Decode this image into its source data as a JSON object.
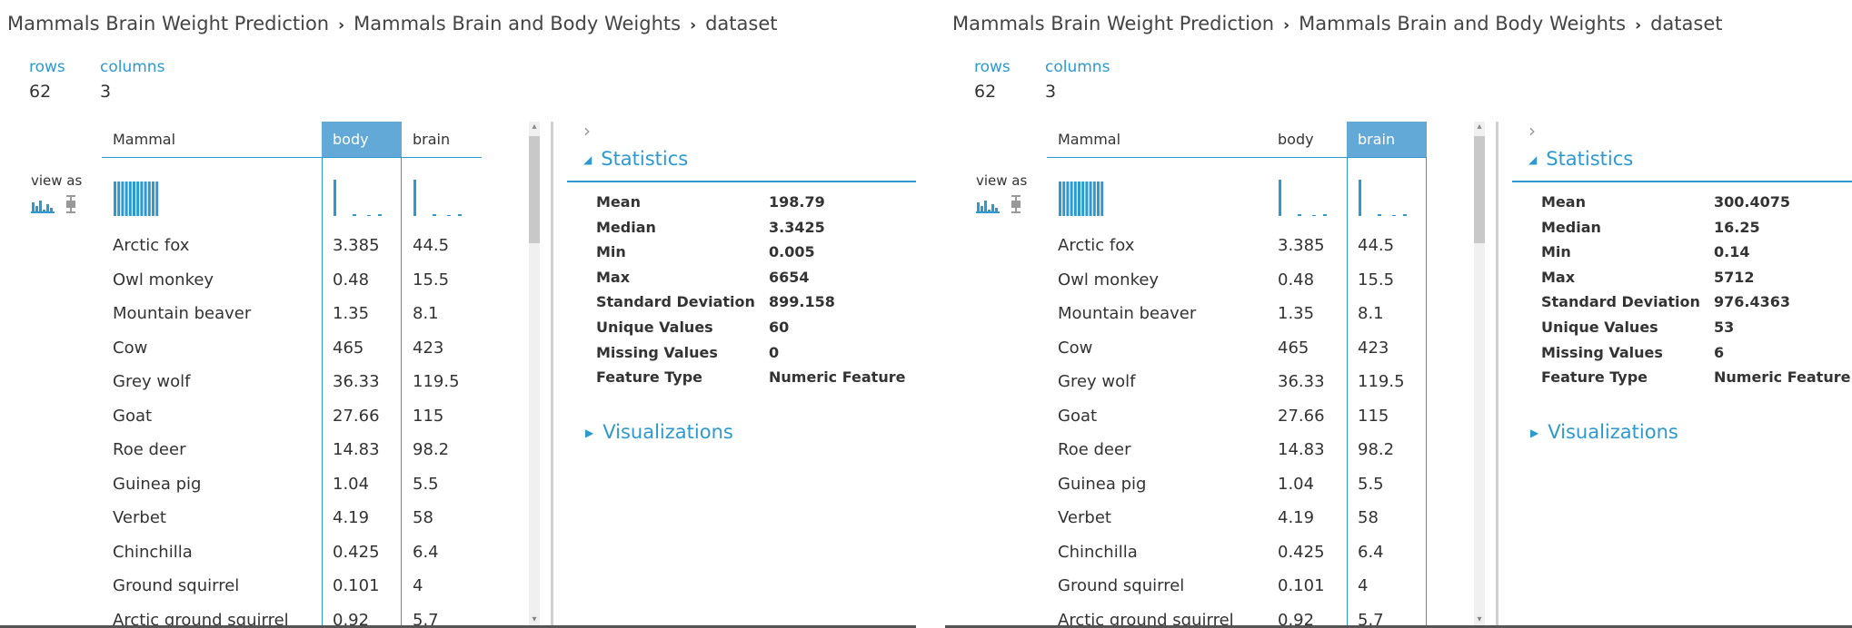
{
  "panels": [
    {
      "breadcrumb": [
        "Mammals Brain Weight Prediction",
        "Mammals Brain and Body Weights",
        "dataset"
      ],
      "rows_label": "rows",
      "rows_value": "62",
      "columns_label": "columns",
      "columns_value": "3",
      "view_as_label": "view as",
      "columns": [
        "Mammal",
        "body",
        "brain"
      ],
      "selected_column": "body",
      "rows": [
        [
          "Arctic fox",
          "3.385",
          "44.5"
        ],
        [
          "Owl monkey",
          "0.48",
          "15.5"
        ],
        [
          "Mountain beaver",
          "1.35",
          "8.1"
        ],
        [
          "Cow",
          "465",
          "423"
        ],
        [
          "Grey wolf",
          "36.33",
          "119.5"
        ],
        [
          "Goat",
          "27.66",
          "115"
        ],
        [
          "Roe deer",
          "14.83",
          "98.2"
        ],
        [
          "Guinea pig",
          "1.04",
          "5.5"
        ],
        [
          "Verbet",
          "4.19",
          "58"
        ],
        [
          "Chinchilla",
          "0.425",
          "6.4"
        ],
        [
          "Ground squirrel",
          "0.101",
          "4"
        ],
        [
          "Arctic ground squirrel",
          "0.92",
          "5.7"
        ]
      ],
      "statistics_title": "Statistics",
      "statistics": [
        {
          "label": "Mean",
          "value": "198.79"
        },
        {
          "label": "Median",
          "value": "3.3425"
        },
        {
          "label": "Min",
          "value": "0.005"
        },
        {
          "label": "Max",
          "value": "6654"
        },
        {
          "label": "Standard Deviation",
          "value": "899.158"
        },
        {
          "label": "Unique Values",
          "value": "60"
        },
        {
          "label": "Missing Values",
          "value": "0"
        },
        {
          "label": "Feature Type",
          "value": "Numeric Feature"
        }
      ],
      "visualizations_title": "Visualizations"
    },
    {
      "breadcrumb": [
        "Mammals Brain Weight Prediction",
        "Mammals Brain and Body Weights",
        "dataset"
      ],
      "rows_label": "rows",
      "rows_value": "62",
      "columns_label": "columns",
      "columns_value": "3",
      "view_as_label": "view as",
      "columns": [
        "Mammal",
        "body",
        "brain"
      ],
      "selected_column": "brain",
      "rows": [
        [
          "Arctic fox",
          "3.385",
          "44.5"
        ],
        [
          "Owl monkey",
          "0.48",
          "15.5"
        ],
        [
          "Mountain beaver",
          "1.35",
          "8.1"
        ],
        [
          "Cow",
          "465",
          "423"
        ],
        [
          "Grey wolf",
          "36.33",
          "119.5"
        ],
        [
          "Goat",
          "27.66",
          "115"
        ],
        [
          "Roe deer",
          "14.83",
          "98.2"
        ],
        [
          "Guinea pig",
          "1.04",
          "5.5"
        ],
        [
          "Verbet",
          "4.19",
          "58"
        ],
        [
          "Chinchilla",
          "0.425",
          "6.4"
        ],
        [
          "Ground squirrel",
          "0.101",
          "4"
        ],
        [
          "Arctic ground squirrel",
          "0.92",
          "5.7"
        ]
      ],
      "statistics_title": "Statistics",
      "statistics": [
        {
          "label": "Mean",
          "value": "300.4075"
        },
        {
          "label": "Median",
          "value": "16.25"
        },
        {
          "label": "Min",
          "value": "0.14"
        },
        {
          "label": "Max",
          "value": "5712"
        },
        {
          "label": "Standard Deviation",
          "value": "976.4363"
        },
        {
          "label": "Unique Values",
          "value": "53"
        },
        {
          "label": "Missing Values",
          "value": "6"
        },
        {
          "label": "Feature Type",
          "value": "Numeric Feature"
        }
      ],
      "visualizations_title": "Visualizations"
    }
  ],
  "colors": {
    "accent": "#2c9ad1",
    "selected_header": "#62a9d8"
  },
  "icons": [
    "histogram-icon",
    "boxplot-icon",
    "expand-chevron-icon",
    "collapse-triangle-icon",
    "expand-triangle-icon"
  ]
}
